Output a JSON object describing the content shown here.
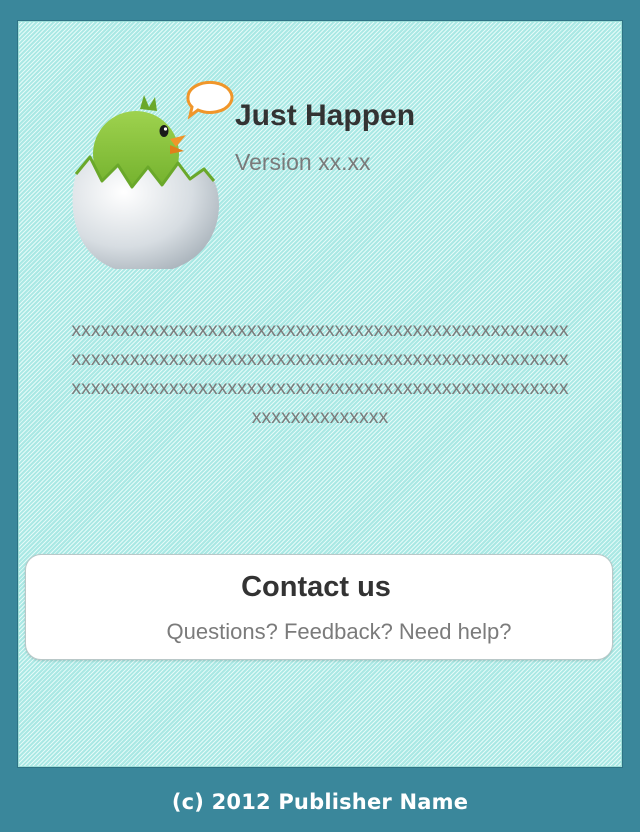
{
  "app": {
    "name": "Just Happen",
    "version": "Version xx.xx",
    "logo_icon": "hatching-chick-icon"
  },
  "description": "xxxxxxxxxxxxxxxxxxxxxxxxxxxxxxxxxxxxxxxxxxxxxxxxxxxxxxxxxxxxxxxxxxxxxxxxxxxxxxxxxxxxxxxxxxxxxxxxxxxxxxxxxxxxxxxxxxxxxxxxxxxxxxxxxxxxxxxxxxxxxxxxxxxxxxxxxxxxxxxxxxxxxxx",
  "contact": {
    "title": "Contact us",
    "subtitle": "Questions? Feedback? Need help?"
  },
  "footer": {
    "copyright": "(c) 2012 Publisher Name"
  },
  "colors": {
    "frame": "#3a879b",
    "panel": "#c4f4f0",
    "chick": "#8bc43f",
    "speech_bubble": "#f0962a"
  }
}
